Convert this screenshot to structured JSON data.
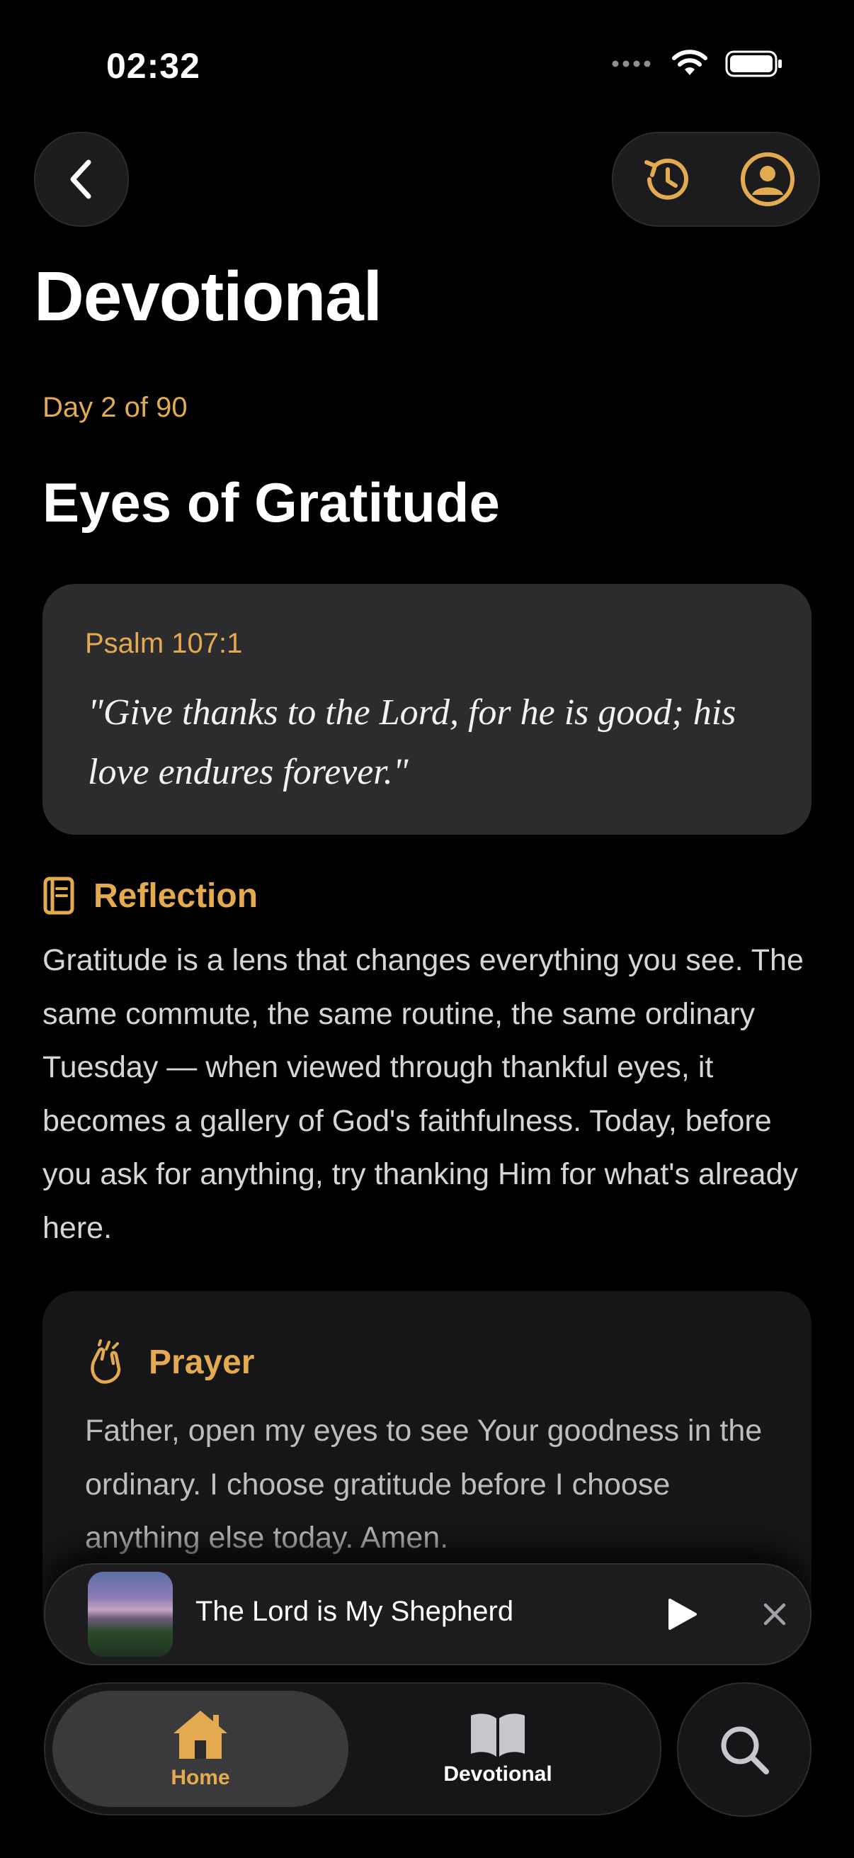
{
  "status_bar": {
    "time": "02:32"
  },
  "header": {
    "title": "Devotional"
  },
  "devotional": {
    "day_label": "Day 2 of 90",
    "title": "Eyes of Gratitude",
    "scripture": {
      "reference": "Psalm 107:1",
      "text": "\"Give thanks to the Lord, for he is good; his love endures forever.\""
    },
    "reflection": {
      "label": "Reflection",
      "body": "Gratitude is a lens that changes everything you see. The same commute, the same routine, the same ordinary Tuesday — when viewed through thankful eyes, it becomes a gallery of God's faithfulness. Today, before you ask for anything, try thanking Him for what's already here."
    },
    "prayer": {
      "label": "Prayer",
      "body": "Father, open my eyes to see Your goodness in the ordinary. I choose gratitude before I choose anything else today. Amen."
    }
  },
  "mini_player": {
    "track_title": "The Lord is My Shepherd"
  },
  "tab_bar": {
    "tabs": [
      {
        "label": "Home",
        "icon": "house-icon",
        "active": true
      },
      {
        "label": "Devotional",
        "icon": "book-icon",
        "active": false
      }
    ]
  },
  "icons": {
    "back": "chevron-left-icon",
    "history": "history-icon",
    "profile": "person-circle-icon",
    "search": "search-icon"
  },
  "colors": {
    "accent": "#e3aa4f",
    "background": "#000000",
    "card": "#2c2c2e"
  }
}
